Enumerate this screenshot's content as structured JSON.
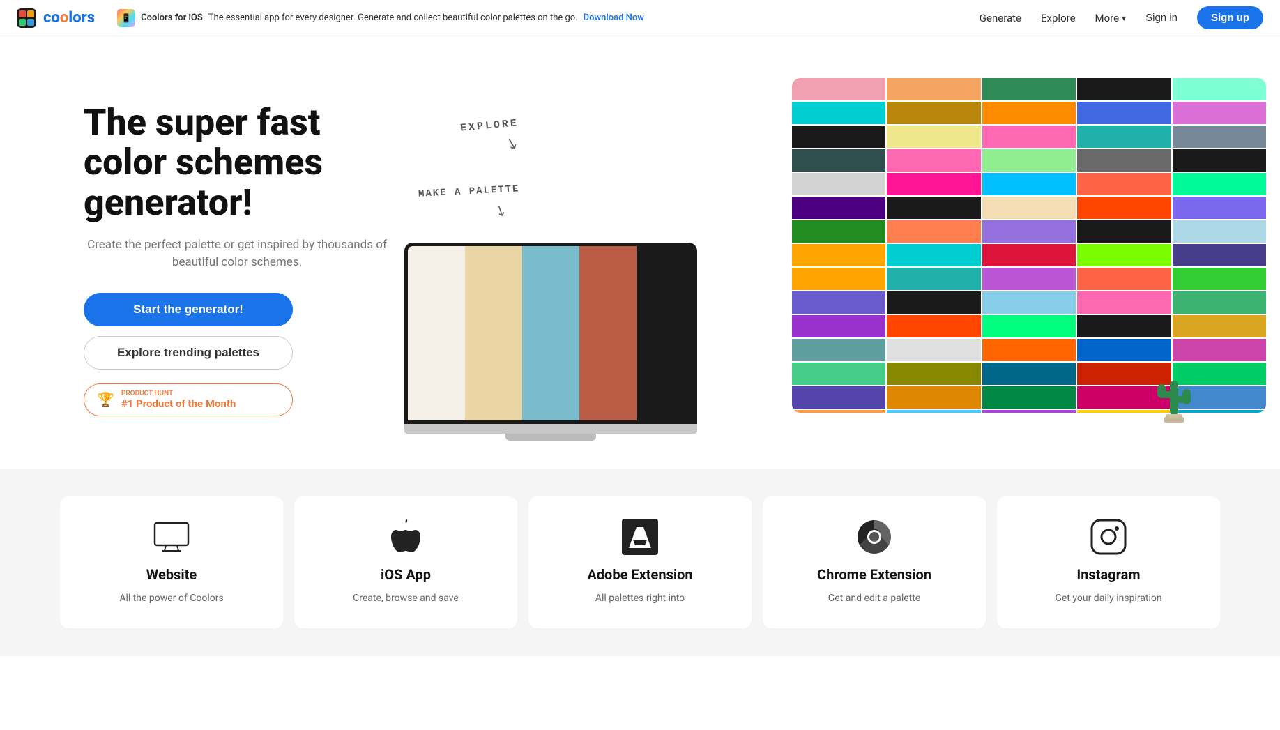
{
  "brand": {
    "name": "coolors",
    "color": "#1a73e8"
  },
  "navbar": {
    "ios_promo_title": "Coolors for iOS",
    "ios_promo_desc": "The essential app for every designer. Generate and collect beautiful color palettes on the go.",
    "ios_promo_link": "Download Now",
    "nav_items": [
      {
        "label": "Generate",
        "id": "generate"
      },
      {
        "label": "Explore",
        "id": "explore"
      }
    ],
    "more_label": "More",
    "signin_label": "Sign in",
    "signup_label": "Sign up"
  },
  "hero": {
    "title": "The super fast color schemes generator!",
    "subtitle": "Create the perfect palette or get inspired by thousands of beautiful color schemes.",
    "cta_primary": "Start the generator!",
    "cta_secondary": "Explore trending palettes",
    "producthunt_label": "Product Hunt",
    "producthunt_text": "#1 Product of the Month"
  },
  "illustration": {
    "explore_label": "EXPLORE",
    "makepalette_label": "MAKE A PALETTE"
  },
  "palette_colors": [
    "#e8b4b8",
    "#f4a460",
    "#2e8b57",
    "#1a1a1a",
    "#98d8c8",
    "#00ced1",
    "#8b7355",
    "#ff8c00",
    "#4169e1",
    "#d4a0d4",
    "#1a1a1a",
    "#f0e68c",
    "#ff69b4",
    "#20b2aa",
    "#2f4f4f",
    "#ff69b4",
    "#8fbc8f",
    "#696969",
    "#1a1a1a",
    "#d3d3d3",
    "#ff1493",
    "#00bfff",
    "#ff6347",
    "#00fa9a",
    "#4b0082",
    "#1a1a1a",
    "#f5deb3",
    "#ff4500",
    "#7b68ee",
    "#228b22",
    "#ff7f50",
    "#9370db",
    "#1a1a1a",
    "#add8e6",
    "#ff8c00",
    "#00ced1",
    "#dc143c",
    "#7cfc00",
    "#483d8b",
    "#ffa500",
    "#20b2aa",
    "#ba55d3",
    "#ff6347",
    "#32cd32",
    "#6a5acd",
    "#1a1a1a",
    "#87ceeb",
    "#ff69b4",
    "#3cb371",
    "#9932cc",
    "#ff4500",
    "#00ff7f",
    "#1a1a1a",
    "#daa520",
    "#5f9ea0"
  ],
  "laptop_palette": [
    "#f5f0e8",
    "#e8d5a3",
    "#7bbccc",
    "#b85c45",
    "#1a1a1a"
  ],
  "cards": [
    {
      "id": "website",
      "icon_type": "monitor",
      "title": "Website",
      "desc": "All the power of Coolors"
    },
    {
      "id": "ios",
      "icon_type": "apple",
      "title": "iOS App",
      "desc": "Create, browse and save"
    },
    {
      "id": "adobe",
      "icon_type": "adobe",
      "title": "Adobe Extension",
      "desc": "All palettes right into"
    },
    {
      "id": "chrome",
      "icon_type": "chrome",
      "title": "Chrome Extension",
      "desc": "Get and edit a palette"
    },
    {
      "id": "instagram",
      "icon_type": "instagram",
      "title": "Instagram",
      "desc": "Get your daily inspiration"
    }
  ]
}
